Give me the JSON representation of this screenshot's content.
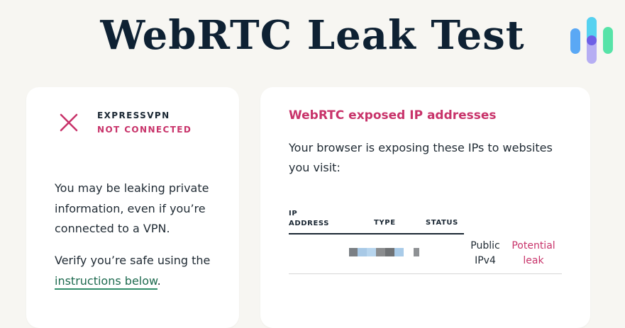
{
  "page": {
    "title": "WebRTC Leak Test"
  },
  "vpn_card": {
    "icon": "x-mark-icon",
    "vpn_name": "EXPRESSVPN",
    "status": "NOT CONNECTED",
    "paragraph1": "You may be leaking private information, even if you’re connected to a VPN.",
    "paragraph2_prefix": "Verify you’re safe using the ",
    "instructions_link": "instructions below",
    "paragraph2_suffix": "."
  },
  "ip_card": {
    "heading": "WebRTC exposed IP addresses",
    "description": "Your browser is exposing these IPs to websites you visit:",
    "table": {
      "headers": [
        "IP ADDRESS",
        "TYPE",
        "STATUS"
      ],
      "rows": [
        {
          "ip": "",
          "type": "Public IPv4",
          "status": "Potential leak"
        }
      ]
    }
  },
  "colors": {
    "background": "#f7f6f2",
    "title": "#0e2133",
    "accent_pink": "#c8336a",
    "link_green": "#1e6a4f",
    "card": "#ffffff"
  }
}
